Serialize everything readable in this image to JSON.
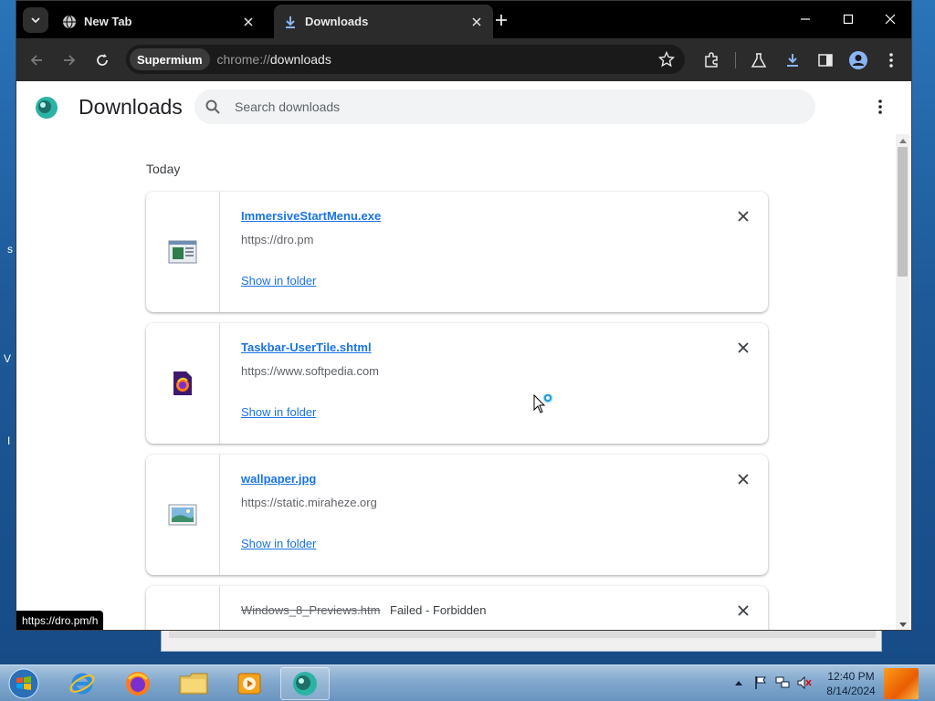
{
  "desktop": {
    "fragments": [
      "s",
      "V",
      "I"
    ]
  },
  "browser": {
    "tabs": [
      {
        "title": "New Tab",
        "icon": "globe-icon",
        "active": false
      },
      {
        "title": "Downloads",
        "icon": "download-arrow-icon",
        "active": true
      }
    ],
    "omnibox": {
      "site_chip": "Supermium",
      "url_scheme": "chrome://",
      "url_path": "downloads"
    }
  },
  "page": {
    "title": "Downloads",
    "search_placeholder": "Search downloads",
    "date_group": "Today",
    "downloads": [
      {
        "filename": "ImmersiveStartMenu.exe",
        "source": "https://dro.pm",
        "action": "Show in folder",
        "status": "",
        "icon": "exe-file-icon"
      },
      {
        "filename": "Taskbar-UserTile.shtml",
        "source": "https://www.softpedia.com",
        "action": "Show in folder",
        "status": "",
        "icon": "firefox-document-icon"
      },
      {
        "filename": "wallpaper.jpg",
        "source": "https://static.miraheze.org",
        "action": "Show in folder",
        "status": "",
        "icon": "image-file-icon"
      },
      {
        "filename": "Windows_8_Previews.htm",
        "source": "",
        "action": "",
        "status": "Failed - Forbidden",
        "icon": "generic-file-icon"
      }
    ],
    "status_bubble": "https://dro.pm/h"
  },
  "taskbar": {
    "apps": [
      "internet-explorer-icon",
      "firefox-icon",
      "file-explorer-icon",
      "media-player-icon",
      "supermium-icon"
    ],
    "clock": {
      "time": "12:40 PM",
      "date": "8/14/2024"
    }
  },
  "colors": {
    "accent": "#1a73e8",
    "tabstrip": "#000000",
    "toolbar": "#2b2b2b"
  }
}
